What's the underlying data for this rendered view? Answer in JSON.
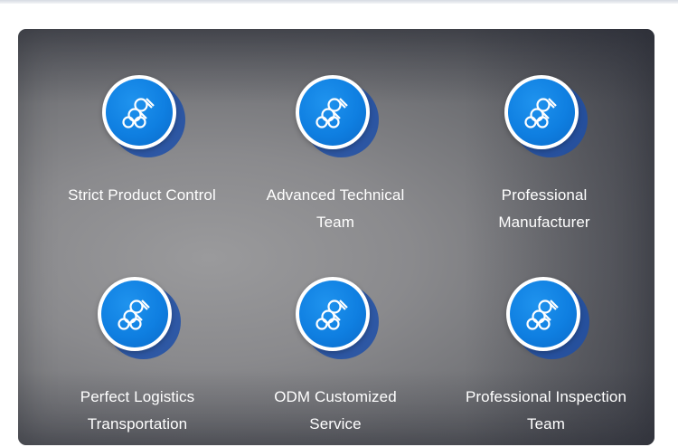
{
  "features": [
    {
      "label_line1": "Strict Product Control",
      "label_line2": "",
      "icon": "steel-pipes-icon"
    },
    {
      "label_line1": "Advanced Technical",
      "label_line2": "Team",
      "icon": "steel-pipes-icon"
    },
    {
      "label_line1": "Professional",
      "label_line2": "Manufacturer",
      "icon": "steel-pipes-icon"
    },
    {
      "label_line1": "Perfect Logistics",
      "label_line2": "Transportation",
      "icon": "steel-pipes-icon"
    },
    {
      "label_line1": "ODM Customized",
      "label_line2": "Service",
      "icon": "steel-pipes-icon"
    },
    {
      "label_line1": "Professional Inspection",
      "label_line2": "Team",
      "icon": "steel-pipes-icon"
    }
  ],
  "colors": {
    "badge_blue": "#0f7fe1",
    "badge_shadow": "#1d4fa8",
    "panel_gray": "#8a8a8d",
    "text": "#ffffff"
  }
}
